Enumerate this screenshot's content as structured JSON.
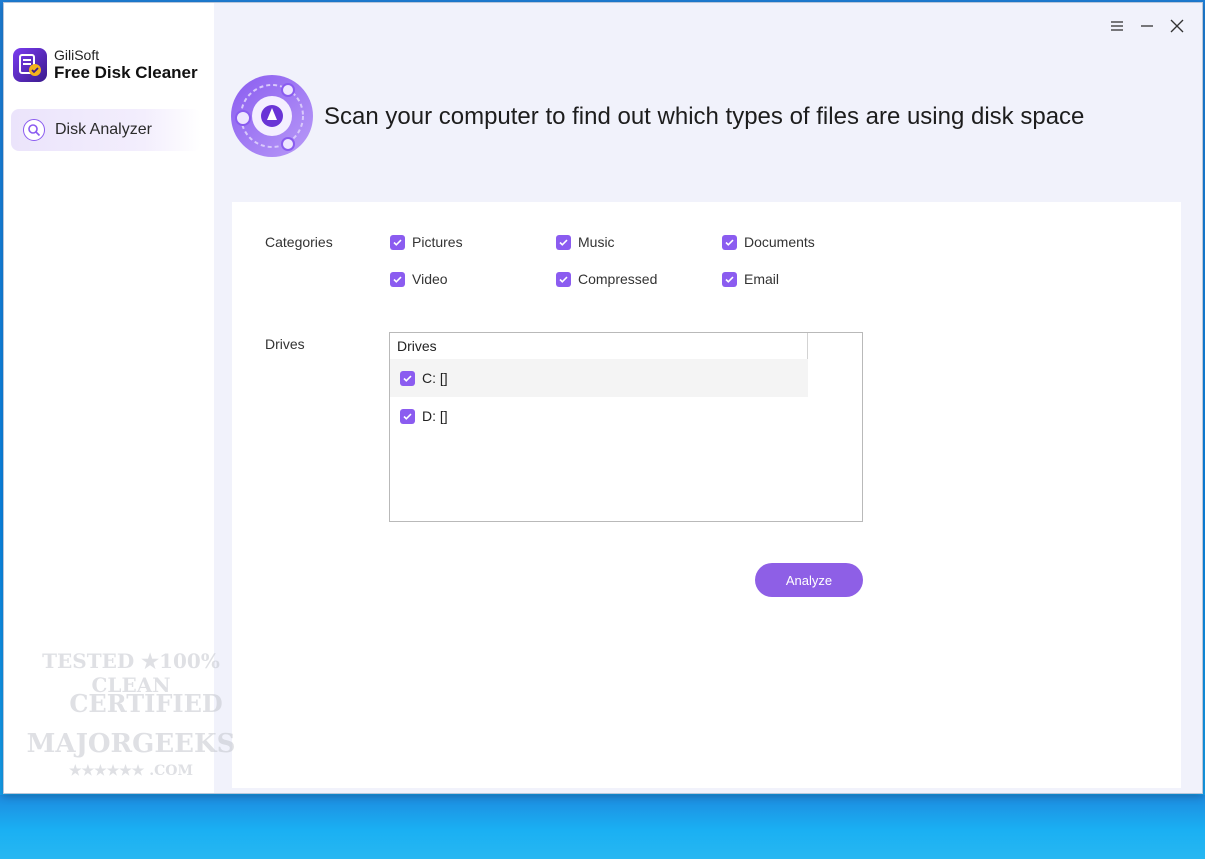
{
  "app": {
    "company": "GiliSoft",
    "product": "Free Disk Cleaner"
  },
  "sidebar": {
    "items": [
      {
        "label": "Disk Analyzer",
        "icon": "disk-analyzer-icon",
        "active": true
      }
    ]
  },
  "titlebar": {
    "icons": [
      "menu-icon",
      "minimize-icon",
      "close-icon"
    ]
  },
  "header": {
    "title": "Scan your computer to find out which types of files are using disk space"
  },
  "categories": {
    "label": "Categories",
    "items": [
      {
        "label": "Pictures",
        "checked": true
      },
      {
        "label": "Music",
        "checked": true
      },
      {
        "label": "Documents",
        "checked": true
      },
      {
        "label": "Video",
        "checked": true
      },
      {
        "label": "Compressed",
        "checked": true
      },
      {
        "label": "Email",
        "checked": true
      }
    ]
  },
  "drives": {
    "label": "Drives",
    "column_header": "Drives",
    "items": [
      {
        "label": "C: []",
        "checked": true
      },
      {
        "label": "D: []",
        "checked": true
      }
    ]
  },
  "actions": {
    "analyze_label": "Analyze"
  },
  "watermark": {
    "line1": "TESTED ★100% CLEAN",
    "line2": "CERTIFIED",
    "line3": "MAJORGEEKS",
    "line4": "★★★★★★ .COM"
  },
  "colors": {
    "accent": "#8b5cf0",
    "button": "#8e5fe6",
    "window_bg": "#f1f2fb",
    "desktop": "#1e8ce0"
  }
}
